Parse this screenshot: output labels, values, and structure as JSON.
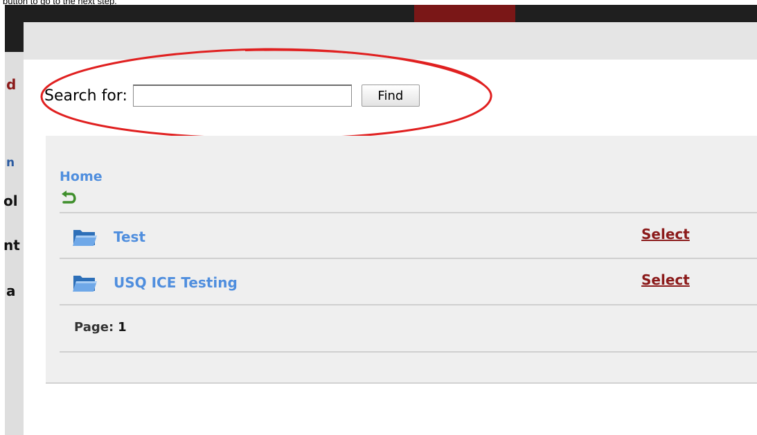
{
  "caption": "button to go to the next step.",
  "background_letters": [
    "d",
    "n",
    "ol",
    "nt",
    "a"
  ],
  "search": {
    "label": "Search for:",
    "value": "",
    "placeholder": "",
    "find_label": "Find"
  },
  "breadcrumb": {
    "home_label": "Home",
    "back_icon": "back-arrow-icon"
  },
  "folders": [
    {
      "name": "Test",
      "icon": "folder-icon",
      "action_label": "Select"
    },
    {
      "name": "USQ ICE Testing",
      "icon": "folder-icon",
      "action_label": "Select"
    }
  ],
  "pager": {
    "label": "Page:",
    "current": "1"
  },
  "colors": {
    "link_blue": "#4f8ede",
    "select_red": "#8b1a1a",
    "highlight_red": "#e02020",
    "panel_bg": "#efefef"
  }
}
